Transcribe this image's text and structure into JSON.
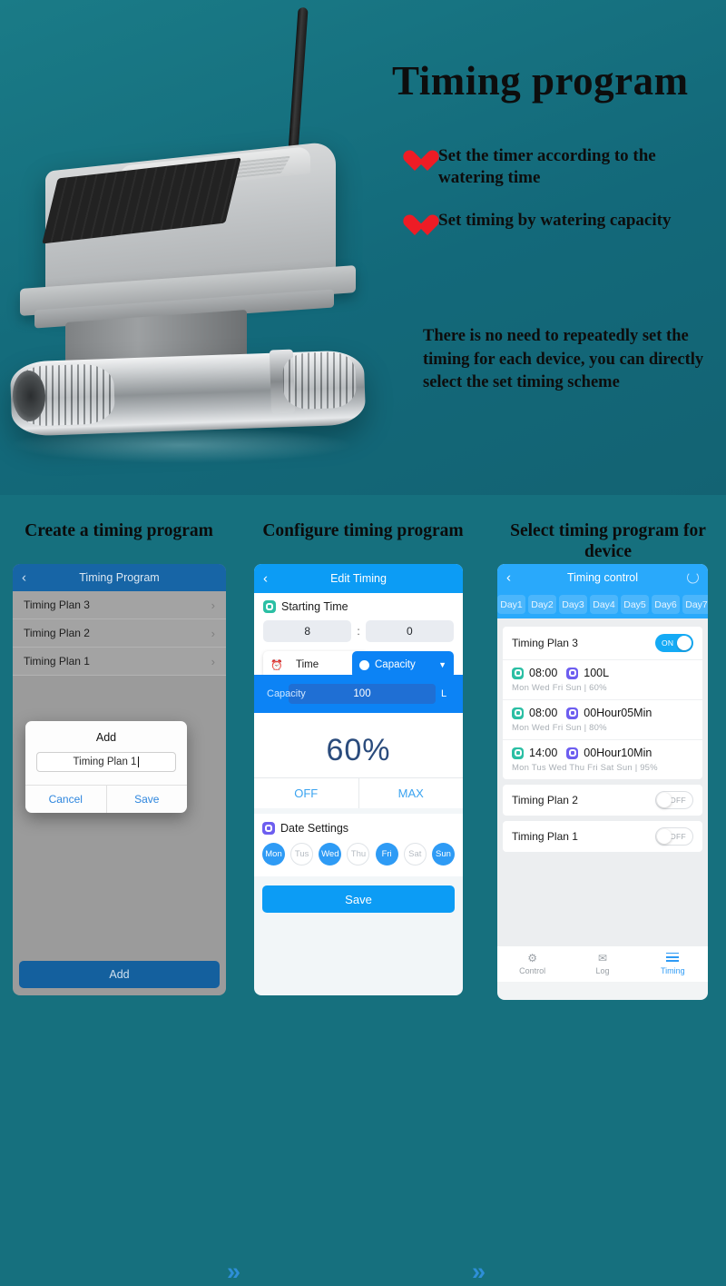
{
  "hero": {
    "title": "Timing program",
    "bullets": [
      "Set the timer according to the watering time",
      "Set timing by watering capacity"
    ],
    "paragraph": "There is no need to repeatedly set the timing for each device, you can directly select the set timing scheme",
    "background_color": "#16707e",
    "heart_color": "#ee1c25"
  },
  "steps": [
    {
      "title": "Create a timing program"
    },
    {
      "title": "Configure timing program"
    },
    {
      "title": "Select timing program for device"
    }
  ],
  "arrows": {
    "glyph": "»"
  },
  "phone1": {
    "header": {
      "title": "Timing Program",
      "back": "‹",
      "bg": "#1765a6"
    },
    "rows": [
      {
        "label": "Timing Plan 3",
        "chevron": "›"
      },
      {
        "label": "Timing Plan 2",
        "chevron": "›"
      },
      {
        "label": "Timing Plan 1",
        "chevron": "›"
      }
    ],
    "dialog": {
      "title": "Add",
      "input_value": "Timing Plan 1",
      "cancel_label": "Cancel",
      "save_label": "Save"
    },
    "add_button": "Add"
  },
  "phone2": {
    "header": {
      "title": "Edit Timing",
      "back": "‹",
      "bg": "#0c9cf5"
    },
    "starting_time": {
      "label": "Starting Time",
      "hour": "8",
      "minute": "0",
      "separator": ":"
    },
    "mode": {
      "left_label": "Time",
      "left_icon": "alarm-clock-icon",
      "right_label": "Capacity",
      "right_icon": "droplet-icon",
      "caret": "▼"
    },
    "capacity": {
      "label": "Capacity",
      "value": "100",
      "unit": "L"
    },
    "percent": "60%",
    "off_label": "OFF",
    "max_label": "MAX",
    "date_settings": {
      "label": "Date Settings",
      "days": [
        {
          "label": "Mon",
          "selected": true
        },
        {
          "label": "Tus",
          "selected": false
        },
        {
          "label": "Wed",
          "selected": true
        },
        {
          "label": "Thu",
          "selected": false
        },
        {
          "label": "Fri",
          "selected": true
        },
        {
          "label": "Sat",
          "selected": false
        },
        {
          "label": "Sun",
          "selected": true
        }
      ]
    },
    "save_label": "Save"
  },
  "phone3": {
    "header": {
      "title": "Timing control",
      "back": "‹",
      "bg": "#29a9fb"
    },
    "day_tabs": [
      "Day1",
      "Day2",
      "Day3",
      "Day4",
      "Day5",
      "Day6",
      "Day7"
    ],
    "plan3": {
      "name": "Timing Plan 3",
      "toggle_label": "ON",
      "toggle_state": "on",
      "schedules": [
        {
          "time": "08:00",
          "amount": "100L",
          "days": "Mon  Wed  Fri  Sun",
          "sep": "|",
          "percent": "60%"
        },
        {
          "time": "08:00",
          "amount": "00Hour05Min",
          "days": "Mon  Wed  Fri  Sun",
          "sep": "|",
          "percent": "80%"
        },
        {
          "time": "14:00",
          "amount": "00Hour10Min",
          "days": "Mon  Tus  Wed  Thu  Fri  Sat  Sun",
          "sep": "|",
          "percent": "95%"
        }
      ]
    },
    "plans": [
      {
        "name": "Timing Plan 2",
        "toggle_label": "OFF",
        "toggle_state": "off"
      },
      {
        "name": "Timing Plan 1",
        "toggle_label": "OFF",
        "toggle_state": "off"
      }
    ],
    "tabbar": [
      {
        "label": "Control",
        "icon": "gear-icon",
        "active": false
      },
      {
        "label": "Log",
        "icon": "envelope-icon",
        "active": false
      },
      {
        "label": "Timing",
        "icon": "list-icon",
        "active": true
      }
    ]
  }
}
